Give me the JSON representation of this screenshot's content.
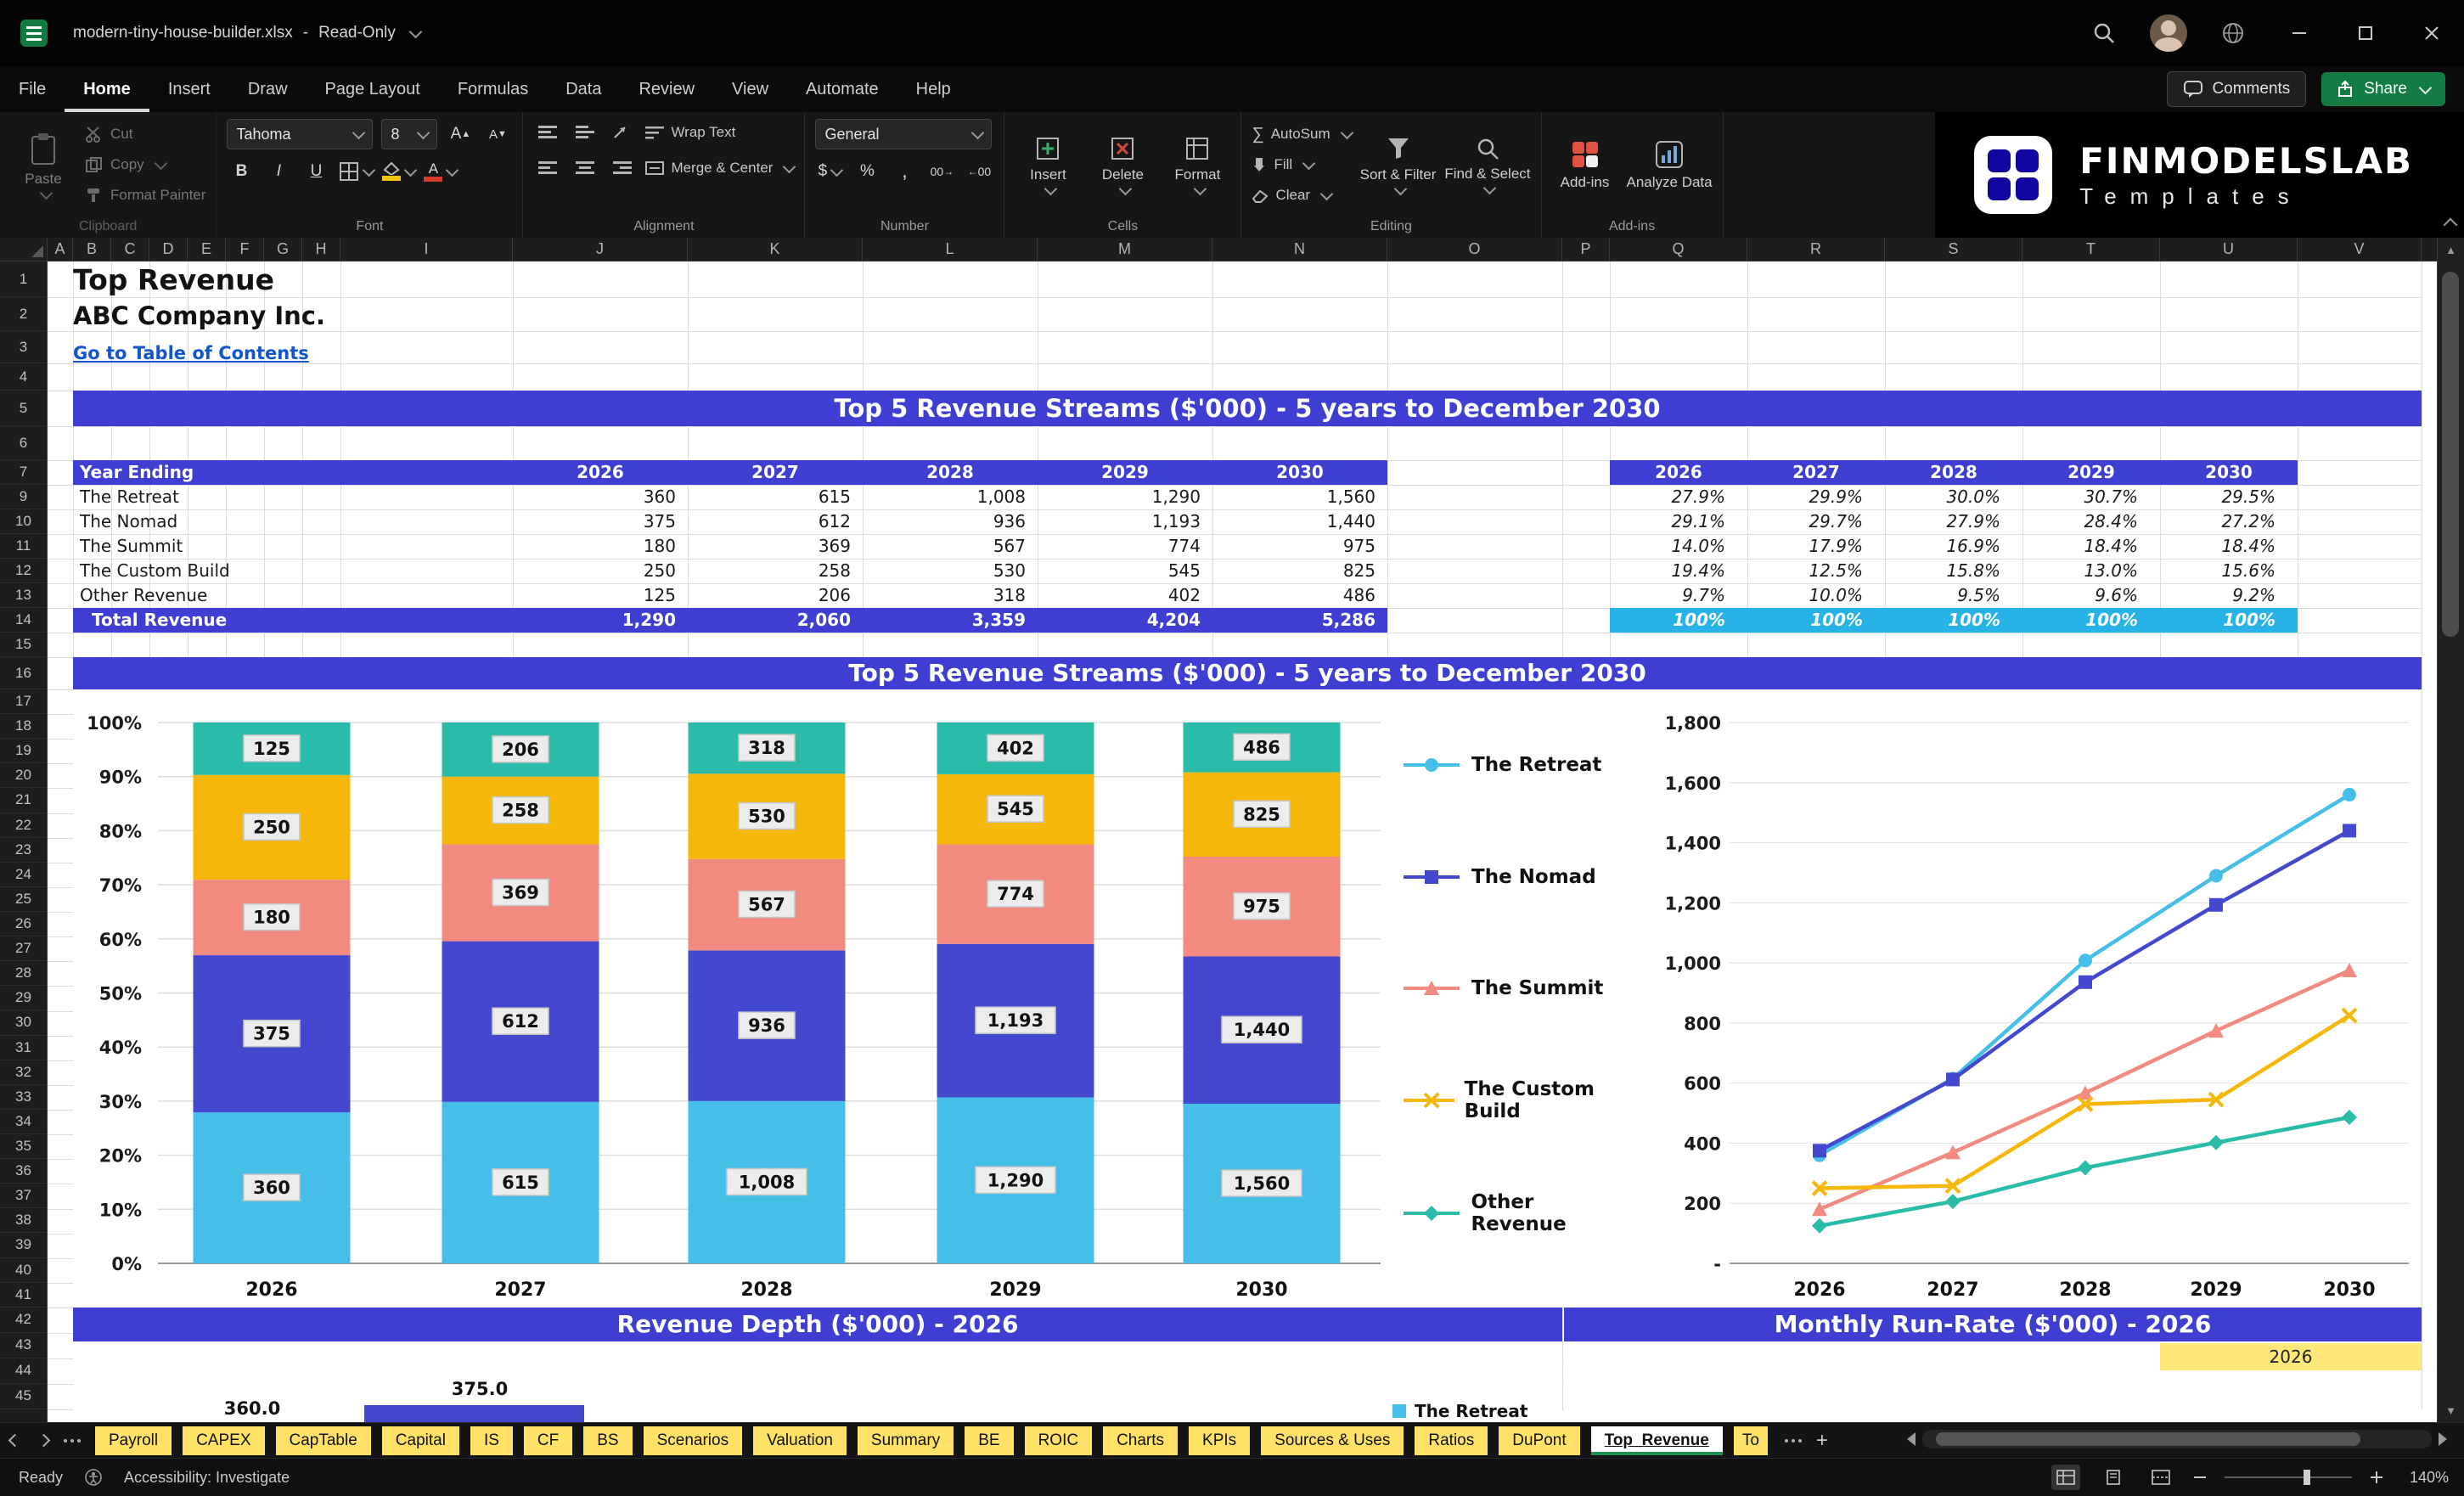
{
  "titlebar": {
    "title": "modern-tiny-house-builder.xlsx",
    "separator": "-",
    "mode": "Read-Only"
  },
  "menu": {
    "items": [
      "File",
      "Home",
      "Insert",
      "Draw",
      "Page Layout",
      "Formulas",
      "Data",
      "Review",
      "View",
      "Automate",
      "Help"
    ],
    "active_index": 1,
    "comments": "Comments",
    "share": "Share"
  },
  "ribbon": {
    "clipboard": {
      "group": "Clipboard",
      "paste": "Paste",
      "cut": "Cut",
      "copy": "Copy",
      "format_painter": "Format Painter"
    },
    "font": {
      "group": "Font",
      "name": "Tahoma",
      "size": "8",
      "bold": "B",
      "italic": "I",
      "underline": "U",
      "grow": "A",
      "shrink": "A",
      "color_label": "A"
    },
    "alignment": {
      "group": "Alignment",
      "wrap": "Wrap Text",
      "merge": "Merge & Center"
    },
    "number": {
      "group": "Number",
      "format": "General",
      "currency": "$",
      "percent": "%",
      "comma": ",",
      "zeros": "00"
    },
    "cells": {
      "group": "Cells",
      "insert": "Insert",
      "delete": "Delete",
      "format": "Format"
    },
    "editing": {
      "group": "Editing",
      "sigma": "∑",
      "autosum": "AutoSum",
      "fill": "Fill",
      "clear": "Clear",
      "sort": "Sort & Filter",
      "find": "Find & Select"
    },
    "addins": {
      "group": "Add-ins",
      "addins": "Add-ins",
      "analyze": "Analyze Data"
    },
    "brand": {
      "name": "FINMODELSLAB",
      "sub": "Templates"
    }
  },
  "grid": {
    "columns": [
      "A",
      "B",
      "C",
      "D",
      "E",
      "F",
      "G",
      "H",
      "I",
      "J",
      "K",
      "L",
      "M",
      "N",
      "O",
      "P",
      "Q",
      "R",
      "S",
      "T",
      "U",
      "V"
    ],
    "rows": [
      1,
      2,
      3,
      4,
      5,
      6,
      7,
      9,
      10,
      11,
      12,
      13,
      14,
      15,
      16,
      17,
      18,
      19,
      20,
      21,
      22,
      23,
      24,
      25,
      26,
      27,
      28,
      29,
      30,
      31,
      32,
      33,
      34,
      35,
      36,
      37,
      38,
      39,
      40,
      41,
      42,
      43,
      44,
      45
    ]
  },
  "sheet": {
    "title": "Top Revenue",
    "company": "ABC Company Inc.",
    "toc_link": "Go to Table of Contents",
    "banner_top": "Top 5 Revenue Streams ($'000) - 5 years to December 2030",
    "banner_chart": "Top 5 Revenue Streams ($'000) - 5 years to December 2030",
    "banner_depth": "Revenue Depth ($'000) - 2026",
    "banner_runrate": "Monthly Run-Rate ($'000) - 2026",
    "table": {
      "header_label": "Year Ending",
      "years": [
        "2026",
        "2027",
        "2028",
        "2029",
        "2030"
      ],
      "rows": [
        {
          "name": "The Retreat",
          "values": [
            "360",
            "615",
            "1,008",
            "1,290",
            "1,560"
          ]
        },
        {
          "name": "The Nomad",
          "values": [
            "375",
            "612",
            "936",
            "1,193",
            "1,440"
          ]
        },
        {
          "name": "The Summit",
          "values": [
            "180",
            "369",
            "567",
            "774",
            "975"
          ]
        },
        {
          "name": "The Custom Build",
          "values": [
            "250",
            "258",
            "530",
            "545",
            "825"
          ]
        },
        {
          "name": "Other Revenue",
          "values": [
            "125",
            "206",
            "318",
            "402",
            "486"
          ]
        }
      ],
      "total_label": "Total Revenue",
      "total_values": [
        "1,290",
        "2,060",
        "3,359",
        "4,204",
        "5,286"
      ]
    },
    "pct_table": {
      "years": [
        "2026",
        "2027",
        "2028",
        "2029",
        "2030"
      ],
      "rows": [
        [
          "27.9%",
          "29.9%",
          "30.0%",
          "30.7%",
          "29.5%"
        ],
        [
          "29.1%",
          "29.7%",
          "27.9%",
          "28.4%",
          "27.2%"
        ],
        [
          "14.0%",
          "17.9%",
          "16.9%",
          "18.4%",
          "18.4%"
        ],
        [
          "19.4%",
          "12.5%",
          "15.8%",
          "13.0%",
          "15.6%"
        ],
        [
          "9.7%",
          "10.0%",
          "9.5%",
          "9.6%",
          "9.2%"
        ]
      ],
      "total": [
        "100%",
        "100%",
        "100%",
        "100%",
        "100%"
      ]
    },
    "runrate_year_cell": "2026"
  },
  "chart_data": [
    {
      "type": "bar",
      "variant": "stacked-100",
      "title": "Top 5 Revenue Streams ($'000) - 5 years to December 2030",
      "categories": [
        "2026",
        "2027",
        "2028",
        "2029",
        "2030"
      ],
      "series": [
        {
          "name": "The Retreat",
          "color": "#45BFE8",
          "marker": "circle",
          "values": [
            360,
            615,
            1008,
            1290,
            1560
          ]
        },
        {
          "name": "The Nomad",
          "color": "#4448CE",
          "marker": "square",
          "values": [
            375,
            612,
            936,
            1193,
            1440
          ]
        },
        {
          "name": "The Summit",
          "color": "#F28A80",
          "marker": "triangle",
          "values": [
            180,
            369,
            567,
            774,
            975
          ]
        },
        {
          "name": "The Custom Build",
          "color": "#F5B80A",
          "marker": "x",
          "values": [
            250,
            258,
            530,
            545,
            825
          ]
        },
        {
          "name": "Other Revenue",
          "color": "#2ABCA8",
          "marker": "diamond",
          "values": [
            125,
            206,
            318,
            402,
            486
          ]
        }
      ],
      "yticks": [
        "0%",
        "10%",
        "20%",
        "30%",
        "40%",
        "50%",
        "60%",
        "70%",
        "80%",
        "90%",
        "100%"
      ],
      "grid": true,
      "legend_position": "right"
    },
    {
      "type": "line",
      "categories": [
        "2026",
        "2027",
        "2028",
        "2029",
        "2030"
      ],
      "series": [
        {
          "name": "The Retreat",
          "color": "#45BFE8",
          "marker": "circle",
          "values": [
            360,
            615,
            1008,
            1290,
            1560
          ]
        },
        {
          "name": "The Nomad",
          "color": "#4448CE",
          "marker": "square",
          "values": [
            375,
            612,
            936,
            1193,
            1440
          ]
        },
        {
          "name": "The Summit",
          "color": "#F28A80",
          "marker": "triangle",
          "values": [
            180,
            369,
            567,
            774,
            975
          ]
        },
        {
          "name": "The Custom Build",
          "color": "#F5B80A",
          "marker": "x",
          "values": [
            250,
            258,
            530,
            545,
            825
          ]
        },
        {
          "name": "Other Revenue",
          "color": "#2ABCA8",
          "marker": "diamond",
          "values": [
            125,
            206,
            318,
            402,
            486
          ]
        }
      ],
      "ylim": [
        0,
        1800
      ],
      "yticks_top_to_bottom": [
        "1,800",
        "1,600",
        "1,400",
        "1,200",
        "1,000",
        "800",
        "600",
        "400",
        "200",
        "-"
      ],
      "grid": true,
      "legend_position": "none"
    },
    {
      "type": "bar",
      "title": "Revenue Depth ($'000) - 2026",
      "note": "partially visible at bottom edge of screen",
      "categories": [
        "The Retreat",
        "The Nomad"
      ],
      "values": [
        360,
        375
      ],
      "data_labels": [
        "360.0",
        "375.0"
      ],
      "bar_color": "#4448CE",
      "legend_visible": [
        "The Retreat"
      ]
    },
    {
      "type": "line",
      "title": "Monthly Run-Rate ($'000) - 2026",
      "note": "only title and year selector cell visible",
      "year": "2026"
    }
  ],
  "tabs": {
    "items": [
      "Payroll",
      "CAPEX",
      "CapTable",
      "Capital",
      "IS",
      "CF",
      "BS",
      "Scenarios",
      "Valuation",
      "Summary",
      "BE",
      "ROIC",
      "Charts",
      "KPIs",
      "Sources & Uses",
      "Ratios",
      "DuPont",
      "Top_Revenue",
      "To"
    ],
    "active": "Top_Revenue",
    "last_clipped": true
  },
  "statusbar": {
    "ready": "Ready",
    "accessibility": "Accessibility: Investigate",
    "zoom": "140%"
  }
}
